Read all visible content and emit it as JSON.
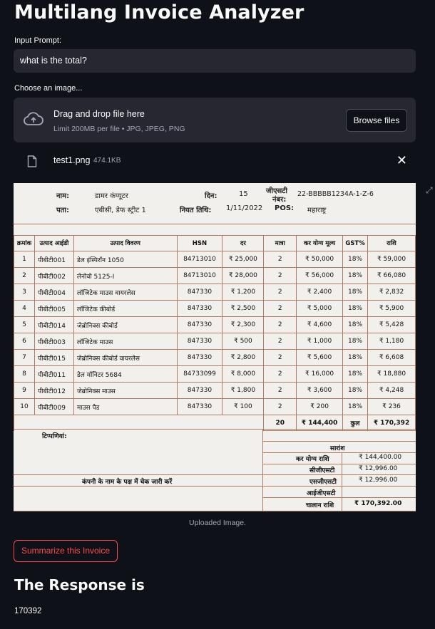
{
  "app": {
    "title": "Multilang Invoice Analyzer",
    "prompt_label": "Input Prompt:",
    "prompt_value": "what is the total?",
    "image_label": "Choose an image...",
    "dropzone_title": "Drag and drop file here",
    "dropzone_limit": "Limit 200MB per file • JPG, JPEG, PNG",
    "browse_label": "Browse files",
    "file_name": "test1.png",
    "file_size": "474.1KB",
    "caption": "Uploaded Image.",
    "summarize_label": "Summarize this Invoice",
    "response_title": "The Response is",
    "response_value": "170392",
    "accent_color": "#ff4b4b"
  },
  "invoice": {
    "name_label": "नाम:",
    "name_value": "डामर कंप्यूटर",
    "address_label": "पता:",
    "address_value": "एबीसी, डेफ स्ट्रीट 1",
    "date_label": "दिन:",
    "date_value": "15",
    "due_label": "नियत तिथि:",
    "due_value": "1/11/2022",
    "gst_label_1": "जीएसटी",
    "gst_label_2": "नंबर:",
    "gst_value": "22-BBBBB1234A-1-Z-6",
    "pos_label": "POS:",
    "pos_value": "महाराष्ट्र",
    "columns": [
      "क्रमांक",
      "उत्पाद आईडी",
      "उत्पाद विवरण",
      "HSN",
      "दर",
      "मात्रा",
      "कर योग्य मूल्य",
      "GST%",
      "राशि"
    ],
    "rows": [
      [
        "1",
        "पीबीटी001",
        "डेल इंस्पिरॉन 1050",
        "84713010",
        "₹ 25,000",
        "2",
        "₹ 50,000",
        "18%",
        "₹ 59,000"
      ],
      [
        "2",
        "पीबीटी002",
        "लेनोवो 5125-I",
        "84713010",
        "₹ 28,000",
        "2",
        "₹ 56,000",
        "18%",
        "₹ 66,080"
      ],
      [
        "3",
        "पीबीटी004",
        "लॉजिटेक माउस वायरलेस",
        "847330",
        "₹ 1,200",
        "2",
        "₹ 2,400",
        "18%",
        "₹ 2,832"
      ],
      [
        "4",
        "पीबीटी005",
        "लॉजिटेक कीबोर्ड",
        "847330",
        "₹ 2,500",
        "2",
        "₹ 5,000",
        "18%",
        "₹ 5,900"
      ],
      [
        "5",
        "पीबीटी014",
        "जेब्रोनिक्स कीबोर्ड",
        "847330",
        "₹ 2,300",
        "2",
        "₹ 4,600",
        "18%",
        "₹ 5,428"
      ],
      [
        "6",
        "पीबीटी003",
        "लॉजिटेक माउस",
        "847330",
        "₹ 500",
        "2",
        "₹ 1,000",
        "18%",
        "₹ 1,180"
      ],
      [
        "7",
        "पीबीटी015",
        "जेब्रोनिक्स कीबोर्ड वायरलेस",
        "847330",
        "₹ 2,800",
        "2",
        "₹ 5,600",
        "18%",
        "₹ 6,608"
      ],
      [
        "8",
        "पीबीटी011",
        "डेल मॉनिटर 5684",
        "84733099",
        "₹ 8,000",
        "2",
        "₹ 16,000",
        "18%",
        "₹ 18,880"
      ],
      [
        "9",
        "पीबीटी012",
        "जेब्रोनिक्स माउस",
        "847330",
        "₹ 1,800",
        "2",
        "₹ 3,600",
        "18%",
        "₹ 4,248"
      ],
      [
        "10",
        "पीबीटी009",
        "माउस पैड",
        "847330",
        "₹ 100",
        "2",
        "₹ 200",
        "18%",
        "₹ 236"
      ]
    ],
    "total_qty": "20",
    "total_taxable": "₹ 144,400",
    "total_label": "कुल",
    "total_amount": "₹ 170,392",
    "notes_label": "टिप्पणियां:",
    "cheque_text": "कंपनी के नाम के पक्ष में चेक जारी करें",
    "summary_title": "सारांश",
    "taxable_label": "कर योग्य राशि",
    "taxable_value": "₹ 144,400.00",
    "cgst_label": "सीजीएसटी",
    "cgst_value": "₹ 12,996.00",
    "sgst_label": "एसजीएसटी",
    "sgst_value": "₹ 12,996.00",
    "igst_label": "आईजीएसटी",
    "igst_value": "",
    "invoice_amount_label": "चालान राशि",
    "invoice_amount_value": "₹ 170,392.00"
  }
}
